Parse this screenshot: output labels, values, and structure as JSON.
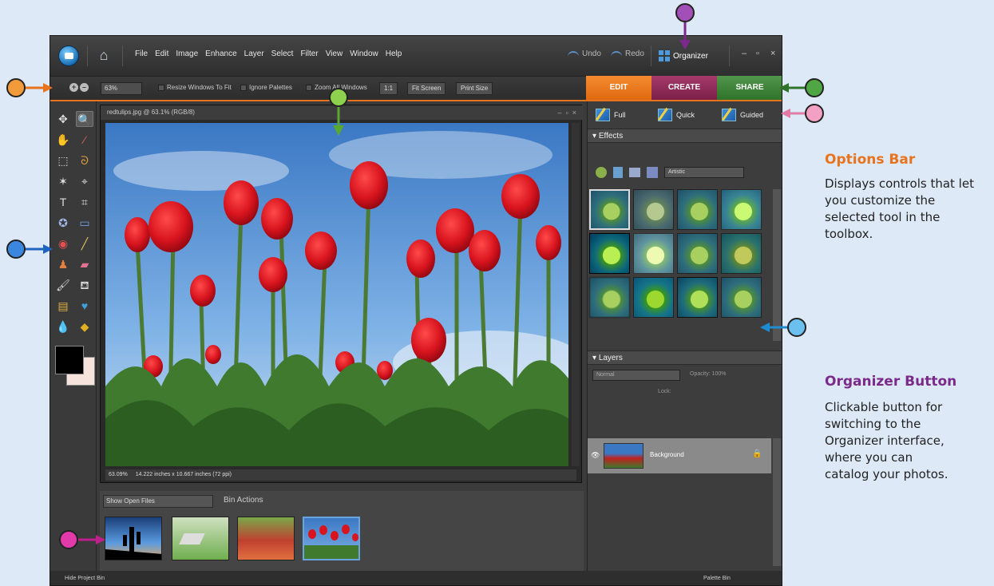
{
  "menu": {
    "items": [
      "File",
      "Edit",
      "Image",
      "Enhance",
      "Layer",
      "Select",
      "Filter",
      "View",
      "Window",
      "Help"
    ],
    "undo": "Undo",
    "redo": "Redo",
    "organizer": "Organizer"
  },
  "options": {
    "zoom": "63%",
    "resize_windows": "Resize Windows To Fit",
    "ignore_palettes": "Ignore Palettes",
    "zoom_all": "Zoom All Windows",
    "actual": "1:1",
    "fit_screen": "Fit Screen",
    "print_size": "Print Size"
  },
  "workspace_tabs": {
    "edit": "EDIT",
    "create": "CREATE",
    "share": "SHARE"
  },
  "document": {
    "title": "redtulips.jpg @ 63.1% (RGB/8)",
    "zoom": "63.09%",
    "size": "14.222 inches x 10.667 inches (72 ppi)"
  },
  "project_bin": {
    "show": "Show Open Files",
    "actions": "Bin Actions",
    "hide": "Hide Project Bin"
  },
  "palette": {
    "modes": [
      "Full",
      "Quick",
      "Guided"
    ],
    "effects_title": "Effects",
    "effects_filter": "Artistic",
    "layers_title": "Layers",
    "blend_mode": "Normal",
    "opacity": "Opacity: 100%",
    "lock": "Lock:",
    "layer_name": "Background",
    "palette_bin": "Palette Bin"
  },
  "annotations": {
    "options_bar": {
      "title": "Options Bar",
      "text": "Displays controls that let you customize the selected tool in the toolbox."
    },
    "organizer_button": {
      "title": "Organizer Button",
      "text": "Clickable button for switching to the Organizer interface, where you can catalog your photos."
    }
  },
  "colors": {
    "options_title": "#e8731f",
    "organizer_title": "#7b2a8c",
    "edit_tab": "#e8731f",
    "create_tab": "#8c2a57",
    "share_tab": "#3e8a38"
  }
}
